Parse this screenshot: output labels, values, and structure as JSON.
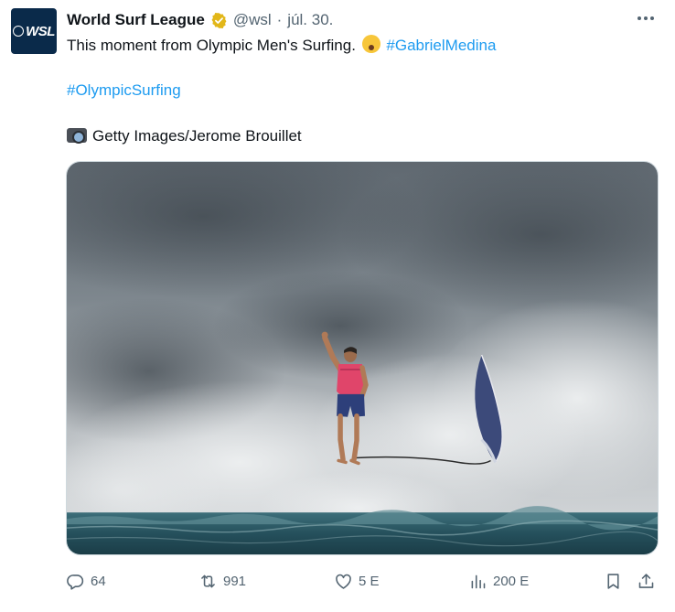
{
  "tweet": {
    "display_name": "World Surf League",
    "handle": "@wsl",
    "separator": "·",
    "date": "júl. 30.",
    "avatar_text": "WSL",
    "text_line1": "This moment from Olympic Men's Surfing.",
    "hashtag1": "#GabrielMedina",
    "hashtag2": "#OlympicSurfing",
    "credit": "Getty Images/Jerome Brouillet"
  },
  "actions": {
    "replies": "64",
    "retweets": "991",
    "likes": "5 E",
    "views": "200 E"
  },
  "colors": {
    "accent": "#1d9bf0",
    "verified_gold": "#e2b719",
    "secondary_text": "#536471"
  },
  "icons": [
    "verified-badge-icon",
    "more-icon",
    "shocked-face-emoji",
    "camera-emoji",
    "reply-icon",
    "retweet-icon",
    "like-icon",
    "views-icon",
    "bookmark-icon",
    "share-icon"
  ]
}
